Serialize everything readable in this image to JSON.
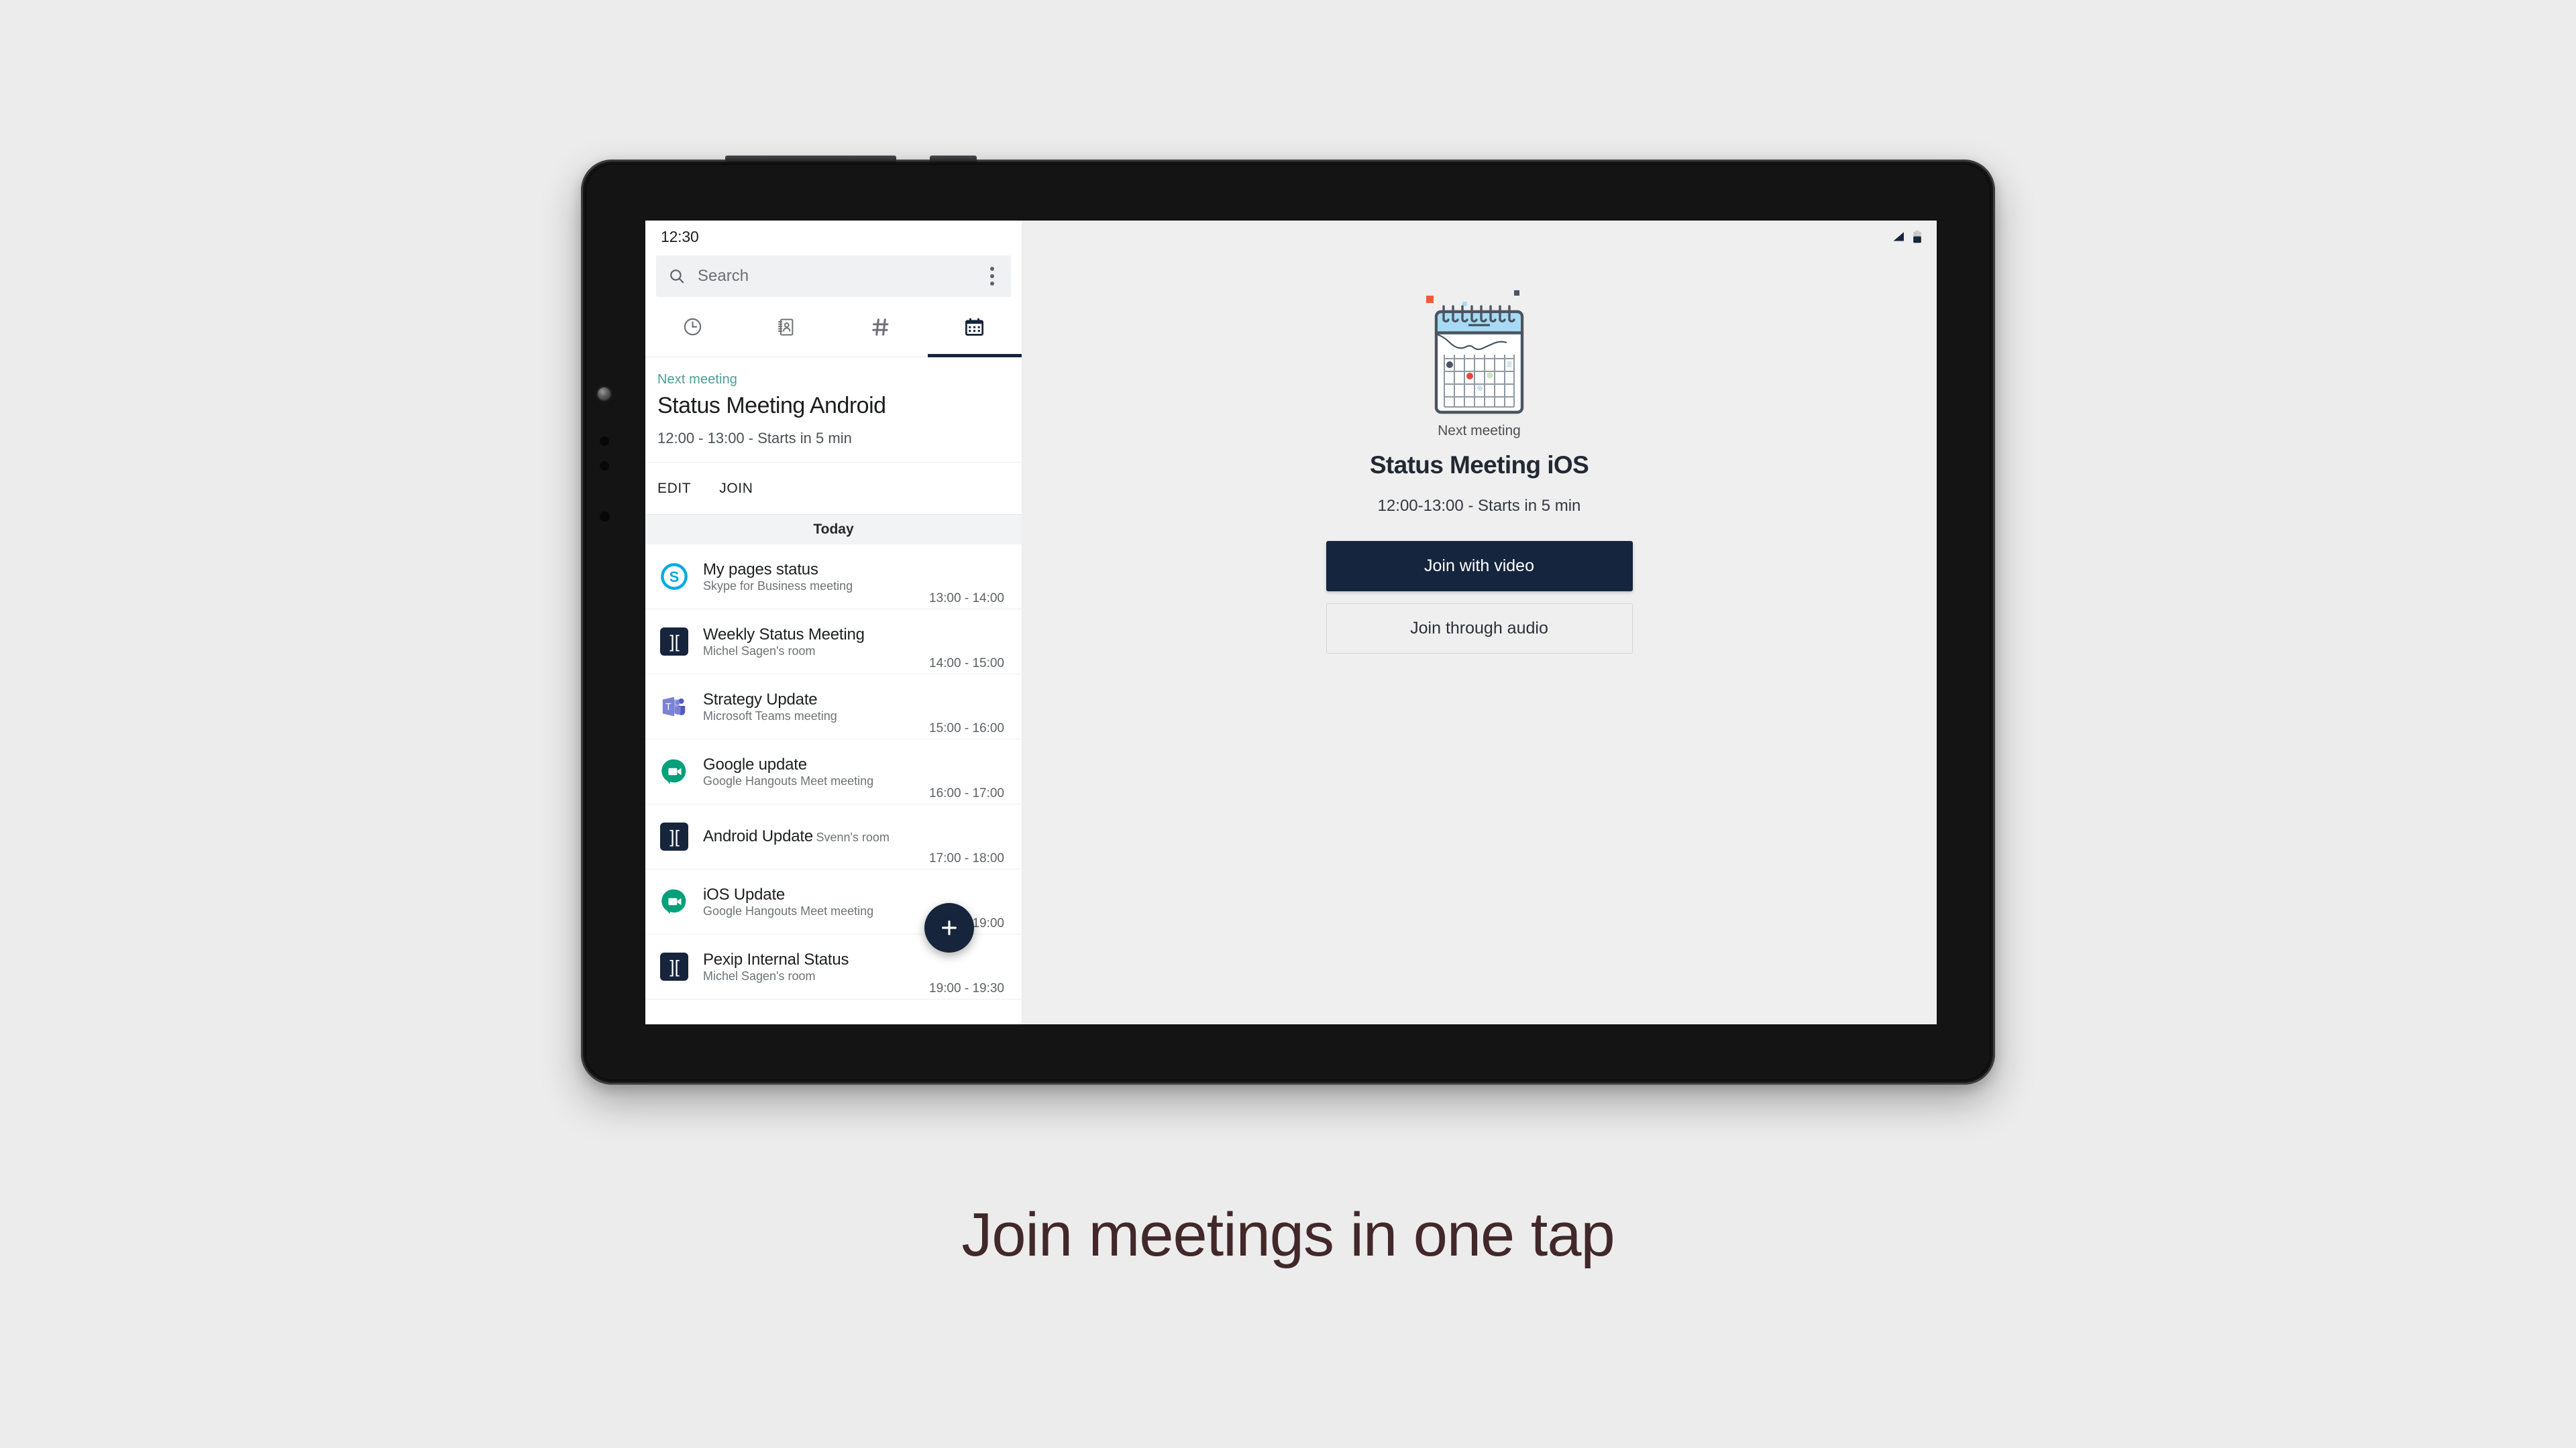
{
  "caption": "Join meetings in one tap",
  "theme": {
    "page_background": "#ececec",
    "brand_navy": "#16253c",
    "accent_teal": "#4f9d96",
    "caption_color": "#42282a",
    "right_panel_background": "#efefef"
  },
  "device": {
    "type": "tablet",
    "bezel_color": "#141414"
  },
  "left_panel": {
    "status_bar": {
      "time": "12:30"
    },
    "search": {
      "placeholder": "Search",
      "value": "",
      "icon": "search-icon",
      "overflow_icon": "overflow-menu-icon"
    },
    "tabs": [
      {
        "id": "recents",
        "icon": "clock-icon",
        "label": "Recents",
        "active": false
      },
      {
        "id": "contacts",
        "icon": "contacts-icon",
        "label": "Contacts",
        "active": false
      },
      {
        "id": "channels",
        "icon": "hash-icon",
        "label": "Channels",
        "active": false
      },
      {
        "id": "calendar",
        "icon": "calendar-icon",
        "label": "Calendar",
        "active": true
      }
    ],
    "next_meeting": {
      "eyebrow": "Next meeting",
      "title": "Status Meeting Android",
      "time": "12:00 - 13:00 - Starts in 5 min",
      "actions": {
        "edit": "EDIT",
        "join": "JOIN"
      }
    },
    "day_header": "Today",
    "meetings": [
      {
        "title": "My pages status",
        "subtitle": "Skype for Business meeting",
        "time": "13:00 - 14:00",
        "icon": "skype-icon"
      },
      {
        "title": "Weekly Status Meeting",
        "subtitle": "Michel Sagen's room",
        "time": "14:00 - 15:00",
        "icon": "pexip-icon"
      },
      {
        "title": "Strategy Update",
        "subtitle": "Microsoft Teams meeting",
        "time": "15:00 - 16:00",
        "icon": "teams-icon"
      },
      {
        "title": "Google update",
        "subtitle": "Google Hangouts Meet meeting",
        "time": "16:00 - 17:00",
        "icon": "google-meet-icon"
      },
      {
        "title": "Android Update",
        "subtitle": "Svenn's room",
        "time": "17:00 - 18:00",
        "icon": "pexip-icon"
      },
      {
        "title": "iOS Update",
        "subtitle": "Google Hangouts Meet meeting",
        "time": "18:00 - 19:00",
        "icon": "google-meet-icon"
      },
      {
        "title": "Pexip Internal Status",
        "subtitle": "Michel Sagen's room",
        "time": "19:00 - 19:30",
        "icon": "pexip-icon"
      }
    ],
    "fab": {
      "icon": "plus-icon",
      "label": "Create meeting"
    }
  },
  "right_panel": {
    "status_icons": [
      "signal-icon",
      "battery-icon"
    ],
    "illustration": "calendar-illustration",
    "eyebrow": "Next meeting",
    "title": "Status Meeting iOS",
    "time": "12:00-13:00 - Starts in 5 min",
    "join_video_label": "Join with video",
    "join_audio_label": "Join through audio"
  }
}
